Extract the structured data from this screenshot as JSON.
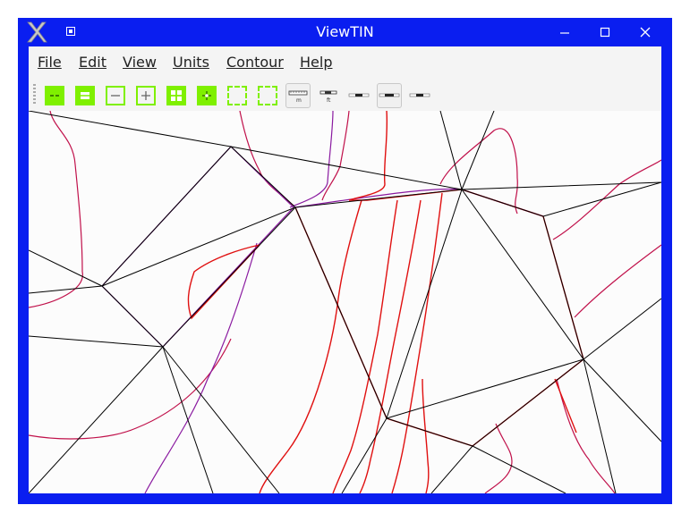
{
  "window": {
    "title": "ViewTIN",
    "minimize_glyph": "—",
    "maximize_glyph": "☐",
    "close_glyph": "✕"
  },
  "menu": [
    {
      "label": "File"
    },
    {
      "label": "Edit"
    },
    {
      "label": "View"
    },
    {
      "label": "Units"
    },
    {
      "label": "Contour"
    },
    {
      "label": "Help"
    }
  ],
  "toolbar": {
    "buttons": [
      {
        "icon": "zoom-out-small-icon"
      },
      {
        "icon": "equals-icon"
      },
      {
        "icon": "minus-icon"
      },
      {
        "icon": "plus-icon"
      },
      {
        "icon": "plus-bold-icon"
      },
      {
        "icon": "crosshair-icon"
      },
      {
        "icon": "blank-icon"
      },
      {
        "icon": "blank-icon"
      },
      {
        "icon": "scale-meters-icon",
        "label": "m"
      },
      {
        "icon": "scale-feet-icon",
        "label": "ft"
      },
      {
        "icon": "line-icon"
      },
      {
        "icon": "line-selected-icon"
      },
      {
        "icon": "line-icon"
      }
    ]
  },
  "colors": {
    "titlebar": "#0a1ef0",
    "tin_edge": "#000000",
    "contour_major": "#e01010",
    "contour_minor": "#c0104a",
    "contour_purple": "#8a1aa0"
  }
}
